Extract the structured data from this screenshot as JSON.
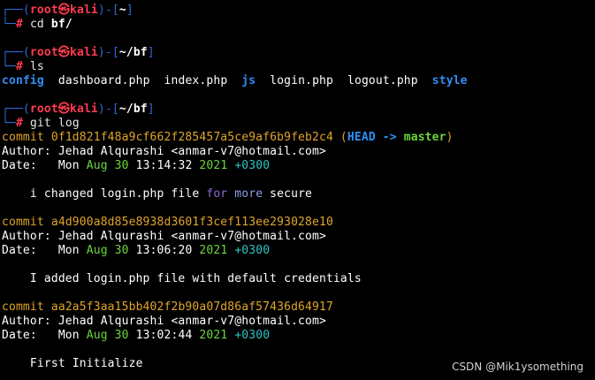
{
  "prompt_user": "root",
  "prompt_skull": "㉿",
  "prompt_host": "kali",
  "prompt_top_prefix": "┌──(",
  "prompt_top_suffix": ")-[",
  "prompt_top_end": "]",
  "prompt_bottom": "└─",
  "prompt_hash": "#",
  "blocks": [
    {
      "path": "~",
      "cmd": "cd",
      "arg": "bf/"
    },
    {
      "path": "~/bf",
      "cmd": "ls",
      "arg": ""
    },
    {
      "path": "~/bf",
      "cmd": "git",
      "arg": "log"
    }
  ],
  "ls_items": [
    {
      "name": "config",
      "type": "dir"
    },
    {
      "name": "dashboard.php",
      "type": "file"
    },
    {
      "name": "index.php",
      "type": "file"
    },
    {
      "name": "js",
      "type": "dir"
    },
    {
      "name": "login.php",
      "type": "file"
    },
    {
      "name": "logout.php",
      "type": "file"
    },
    {
      "name": "style",
      "type": "dir"
    }
  ],
  "git_log": {
    "commit_word": "commit",
    "author_label": "Author:",
    "date_label": "Date:",
    "head_ref": "HEAD ->",
    "branch": "master",
    "commits": [
      {
        "hash": "0f1d821f48a9cf662f285457a5ce9af6b9feb2c4",
        "author": "Jehad Alqurashi <anmar-v7@hotmail.com>",
        "weekday": "Mon",
        "month_day": "Aug 30",
        "time": "13:14:32",
        "year": "2021",
        "tz": "+0300",
        "msg_a": "i changed login.php file ",
        "msg_kw1": "for",
        "msg_kw2": "more",
        "msg_b": " secure"
      },
      {
        "hash": "a4d900a8d85e8938d3601f3cef113ee293028e10",
        "author": "Jehad Alqurashi <anmar-v7@hotmail.com>",
        "weekday": "Mon",
        "month_day": "Aug 30",
        "time": "13:06:20",
        "year": "2021",
        "tz": "+0300",
        "message": "I added login.php file with default credentials"
      },
      {
        "hash": "aa2a5f3aa15bb402f2b90a07d86af57436d64917",
        "author": "Jehad Alqurashi <anmar-v7@hotmail.com>",
        "weekday": "Mon",
        "month_day": "Aug 30",
        "time": "13:02:44",
        "year": "2021",
        "tz": "+0300",
        "message": "First Initialize"
      }
    ]
  },
  "watermark": "CSDN @Mik1ysomething",
  "colors": {
    "background": "#000000",
    "prompt_frame": "#2c6ad7",
    "prompt_user": "#ff3b4e",
    "directory": "#2f8ff5",
    "commit_hash": "#e1a52a",
    "branch": "#6bd63b",
    "timezone": "#2fc3c6"
  }
}
